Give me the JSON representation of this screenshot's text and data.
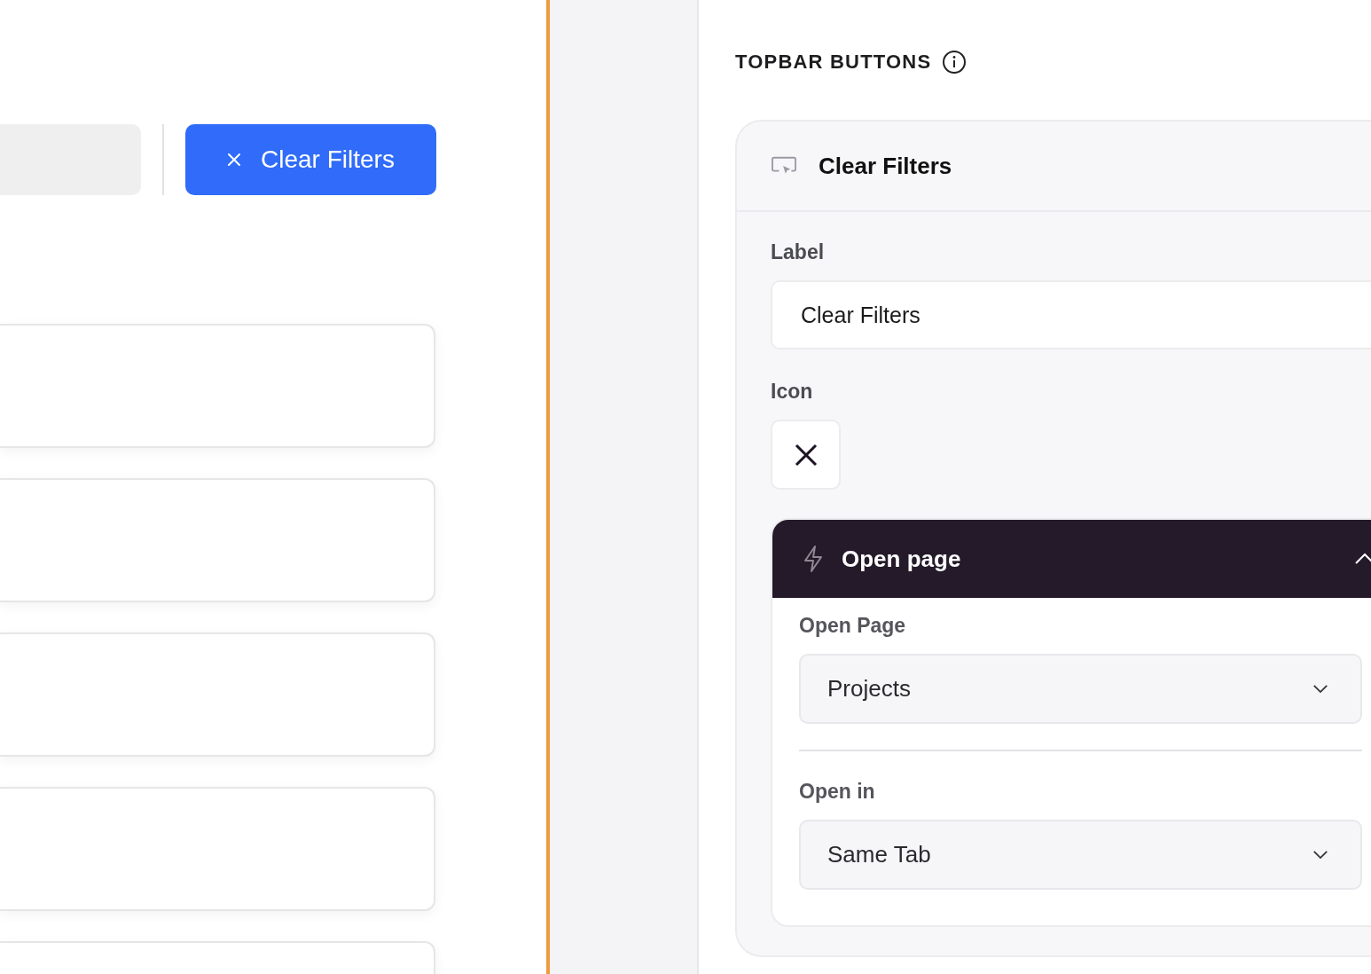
{
  "preview": {
    "button_label": "Clear Filters"
  },
  "settings": {
    "heading": "TOPBAR BUTTONS",
    "button_card": {
      "title": "Clear Filters",
      "label_field": {
        "label": "Label",
        "value": "Clear Filters"
      },
      "icon_field": {
        "label": "Icon"
      },
      "action": {
        "title": "Open page",
        "open_page": {
          "label": "Open Page",
          "value": "Projects"
        },
        "open_in": {
          "label": "Open in",
          "value": "Same Tab"
        }
      }
    }
  }
}
